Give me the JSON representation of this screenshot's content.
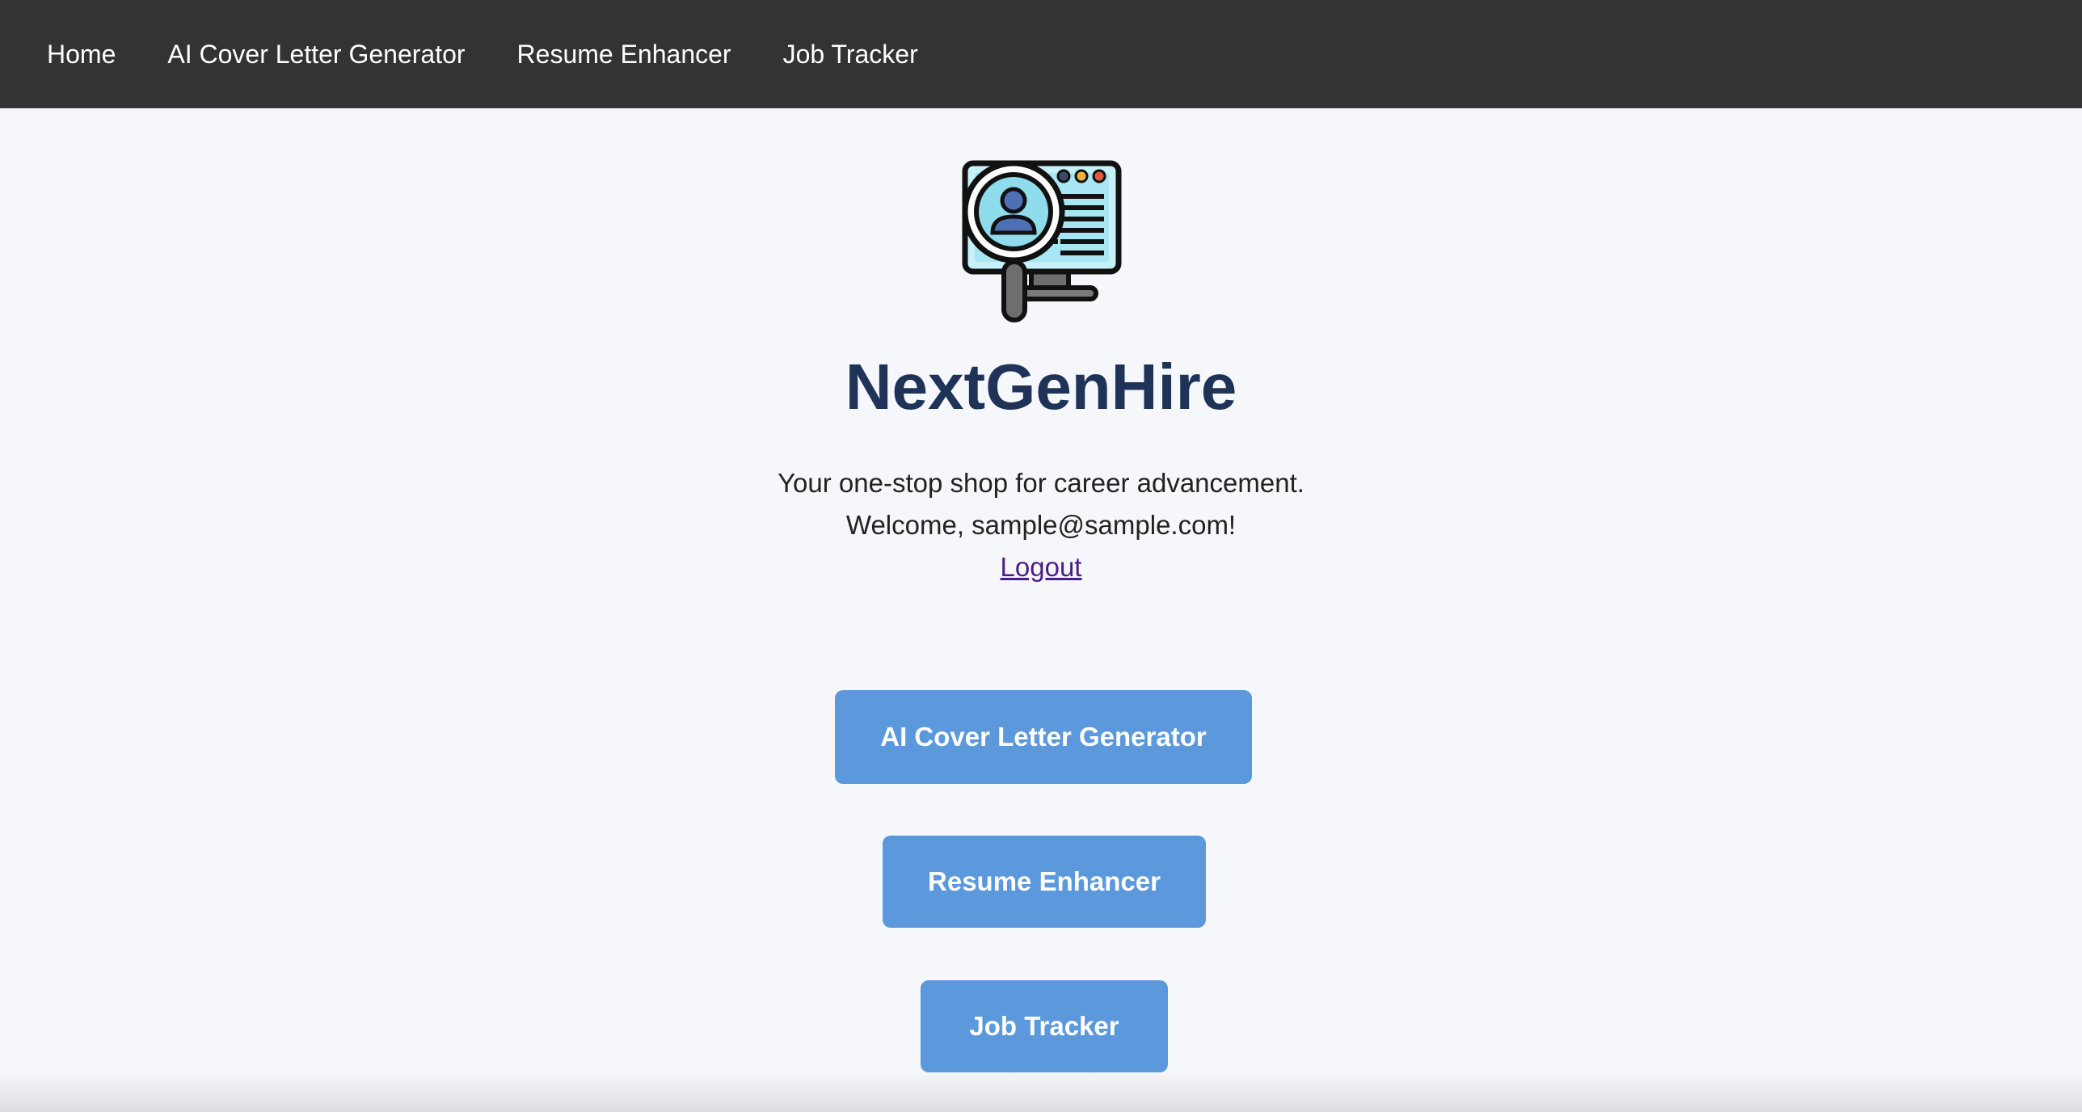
{
  "nav": {
    "items": [
      {
        "label": "Home"
      },
      {
        "label": "AI Cover Letter Generator"
      },
      {
        "label": "Resume Enhancer"
      },
      {
        "label": "Job Tracker"
      }
    ]
  },
  "hero": {
    "logo_icon": "monitor-magnifier-profile-icon",
    "title": "NextGenHire",
    "tagline": "Your one-stop shop for career advancement.",
    "welcome": "Welcome, sample@sample.com!",
    "logout_label": "Logout"
  },
  "actions": {
    "cover_letter_label": "AI Cover Letter Generator",
    "resume_label": "Resume Enhancer",
    "job_tracker_label": "Job Tracker"
  },
  "colors": {
    "nav_bg": "#333333",
    "page_bg": "#f5f7fb",
    "title": "#1f3358",
    "button_bg": "#5b98dc",
    "link": "#4b1d8b"
  }
}
